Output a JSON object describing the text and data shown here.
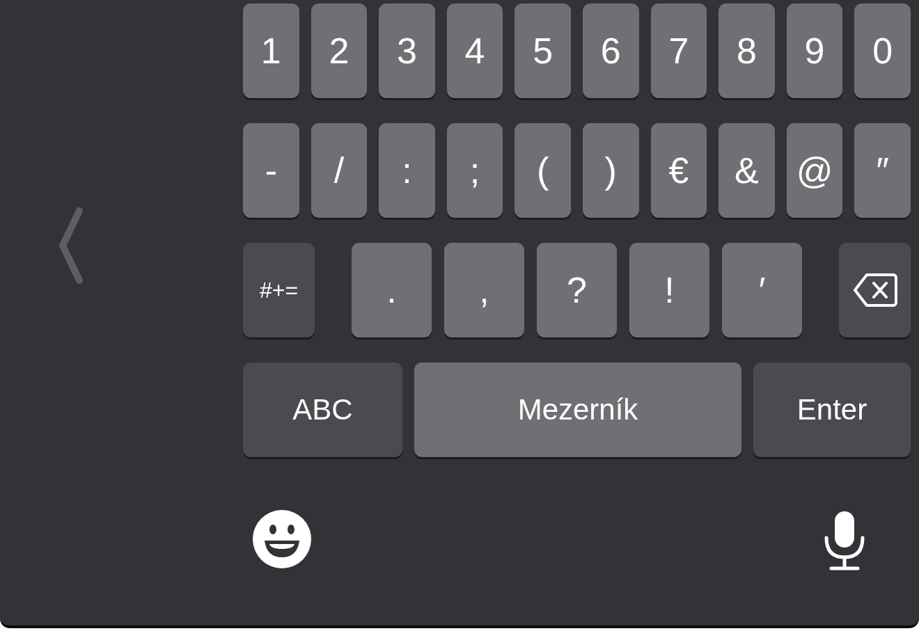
{
  "rows": [
    {
      "keys": [
        {
          "kind": "char",
          "label": "1"
        },
        {
          "kind": "char",
          "label": "2"
        },
        {
          "kind": "char",
          "label": "3"
        },
        {
          "kind": "char",
          "label": "4"
        },
        {
          "kind": "char",
          "label": "5"
        },
        {
          "kind": "char",
          "label": "6"
        },
        {
          "kind": "char",
          "label": "7"
        },
        {
          "kind": "char",
          "label": "8"
        },
        {
          "kind": "char",
          "label": "9"
        },
        {
          "kind": "char",
          "label": "0"
        }
      ]
    },
    {
      "keys": [
        {
          "kind": "char",
          "label": "-"
        },
        {
          "kind": "char",
          "label": "/"
        },
        {
          "kind": "char",
          "label": ":"
        },
        {
          "kind": "char",
          "label": ";"
        },
        {
          "kind": "char",
          "label": "("
        },
        {
          "kind": "char",
          "label": ")"
        },
        {
          "kind": "char",
          "label": "€"
        },
        {
          "kind": "char",
          "label": "&"
        },
        {
          "kind": "char",
          "label": "@"
        },
        {
          "kind": "char",
          "label": "″"
        }
      ]
    },
    {
      "keys": [
        {
          "kind": "symbols",
          "label": "#+="
        },
        {
          "kind": "char",
          "label": "."
        },
        {
          "kind": "char",
          "label": ","
        },
        {
          "kind": "char",
          "label": "?"
        },
        {
          "kind": "char",
          "label": "!"
        },
        {
          "kind": "char",
          "label": "′"
        },
        {
          "kind": "backspace"
        }
      ]
    },
    {
      "keys": [
        {
          "kind": "mode",
          "label": "ABC"
        },
        {
          "kind": "space",
          "label": "Mezerník"
        },
        {
          "kind": "enter",
          "label": "Enter"
        }
      ]
    }
  ]
}
